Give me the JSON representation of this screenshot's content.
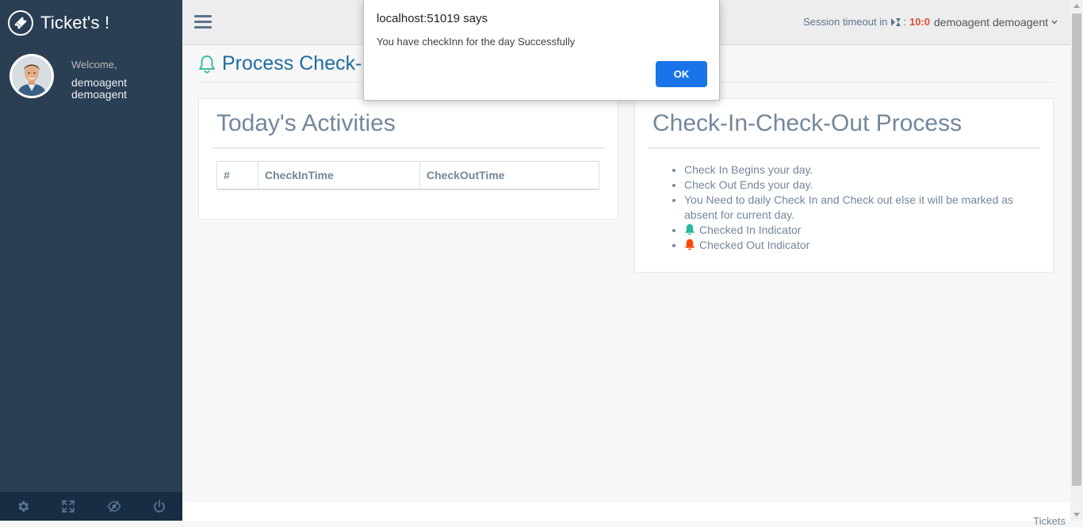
{
  "sidebar": {
    "brand": "Ticket's !",
    "welcome": "Welcome,",
    "username": "demoagent demoagent",
    "footer_icons": [
      "gear-icon",
      "fullscreen-icon",
      "eye-slash-icon",
      "power-icon"
    ]
  },
  "topnav": {
    "session_label": "Session timeout in",
    "session_separator": ":",
    "session_timer": "10:0",
    "user_menu": "demoagent demoagent"
  },
  "page": {
    "title": "Process Check-I"
  },
  "activities": {
    "title": "Today's Activities",
    "columns": [
      "#",
      "CheckInTime",
      "CheckOutTime"
    ]
  },
  "process": {
    "title": "Check-In-Check-Out Process",
    "items": [
      "Check In Begins your day.",
      "Check Out Ends your day.",
      "You Need to daily Check In and Check out else it will be marked as absent for current day.",
      "Checked In Indicator",
      "Checked Out Indicator"
    ]
  },
  "footer": {
    "text": "Tickets"
  },
  "dialog": {
    "title": "localhost:51019 says",
    "message": "You have checkInn for the day Successfully",
    "ok_label": "OK"
  },
  "colors": {
    "sidebar_bg": "#2A3F54",
    "accent_blue": "#1A73E8",
    "checked_in": "#26B99A",
    "checked_out": "#FF4500",
    "timer": "#E74C3C"
  }
}
